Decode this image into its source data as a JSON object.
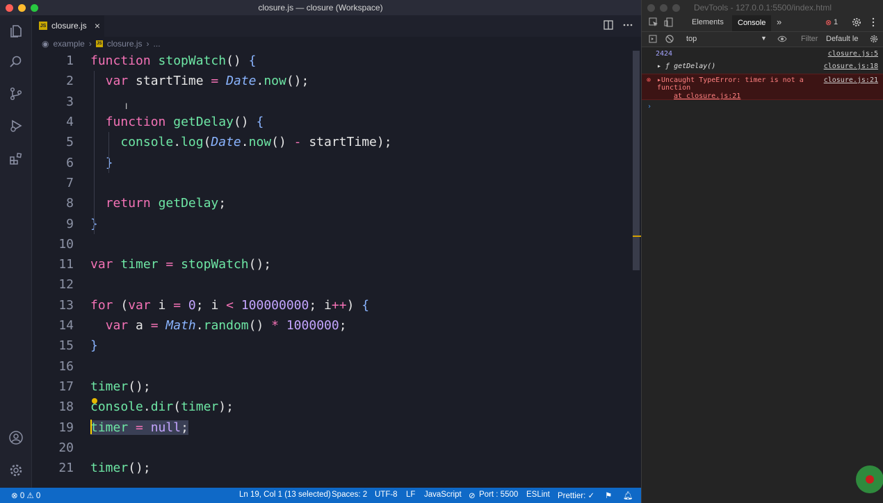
{
  "window": {
    "title": "closure.js — closure (Workspace)"
  },
  "editor_tab": {
    "label": "closure.js",
    "badge": "JS",
    "close": "×"
  },
  "breadcrumb": {
    "folder": "example",
    "file": "closure.js",
    "more": "..."
  },
  "code_lines": [
    "function stopWatch() {",
    "  var startTime = Date.now();",
    "",
    "  function getDelay() {",
    "    console.log(Date.now() - startTime);",
    "  }",
    "",
    "  return getDelay;",
    "}",
    "",
    "var timer = stopWatch();",
    "",
    "for (var i = 0; i < 100000000; i++) {",
    "  var a = Math.random() * 1000000;",
    "}",
    "",
    "timer();",
    "console.dir(timer);",
    "timer = null;",
    "",
    "timer();"
  ],
  "line_numbers": [
    "1",
    "2",
    "3",
    "4",
    "5",
    "6",
    "7",
    "8",
    "9",
    "10",
    "11",
    "12",
    "13",
    "14",
    "15",
    "16",
    "17",
    "18",
    "19",
    "20",
    "21"
  ],
  "statusbar": {
    "problems": "⊗ 0 ⚠ 0",
    "position": "Ln 19, Col 1 (13 selected)",
    "spaces": "Spaces: 2",
    "encoding": "UTF-8",
    "eol": "LF",
    "language": "JavaScript",
    "port": "Port : 5500",
    "eslint": "ESLint",
    "prettier": "Prettier: ✓"
  },
  "devtools": {
    "title": "DevTools - 127.0.0.1:5500/index.html",
    "tabs": {
      "elements": "Elements",
      "console": "Console",
      "more": "»",
      "error_count": "1"
    },
    "toolbar": {
      "context": "top",
      "filter": "Filter",
      "levels": "Default le"
    },
    "messages": [
      {
        "text": "2424",
        "source": "closure.js:5"
      },
      {
        "text": "▸ ƒ getDelay()",
        "source": "closure.js:18"
      },
      {
        "text": "▸Uncaught TypeError: timer is not a function",
        "detail": "at closure.js:21",
        "source": "closure.js:21"
      }
    ],
    "prompt": "›"
  },
  "colors": {
    "statusbar": "#0f69c7",
    "keyword": "#f472b6",
    "function": "#6ee7a5",
    "number": "#c4a5ff",
    "class": "#8ab4ff"
  }
}
